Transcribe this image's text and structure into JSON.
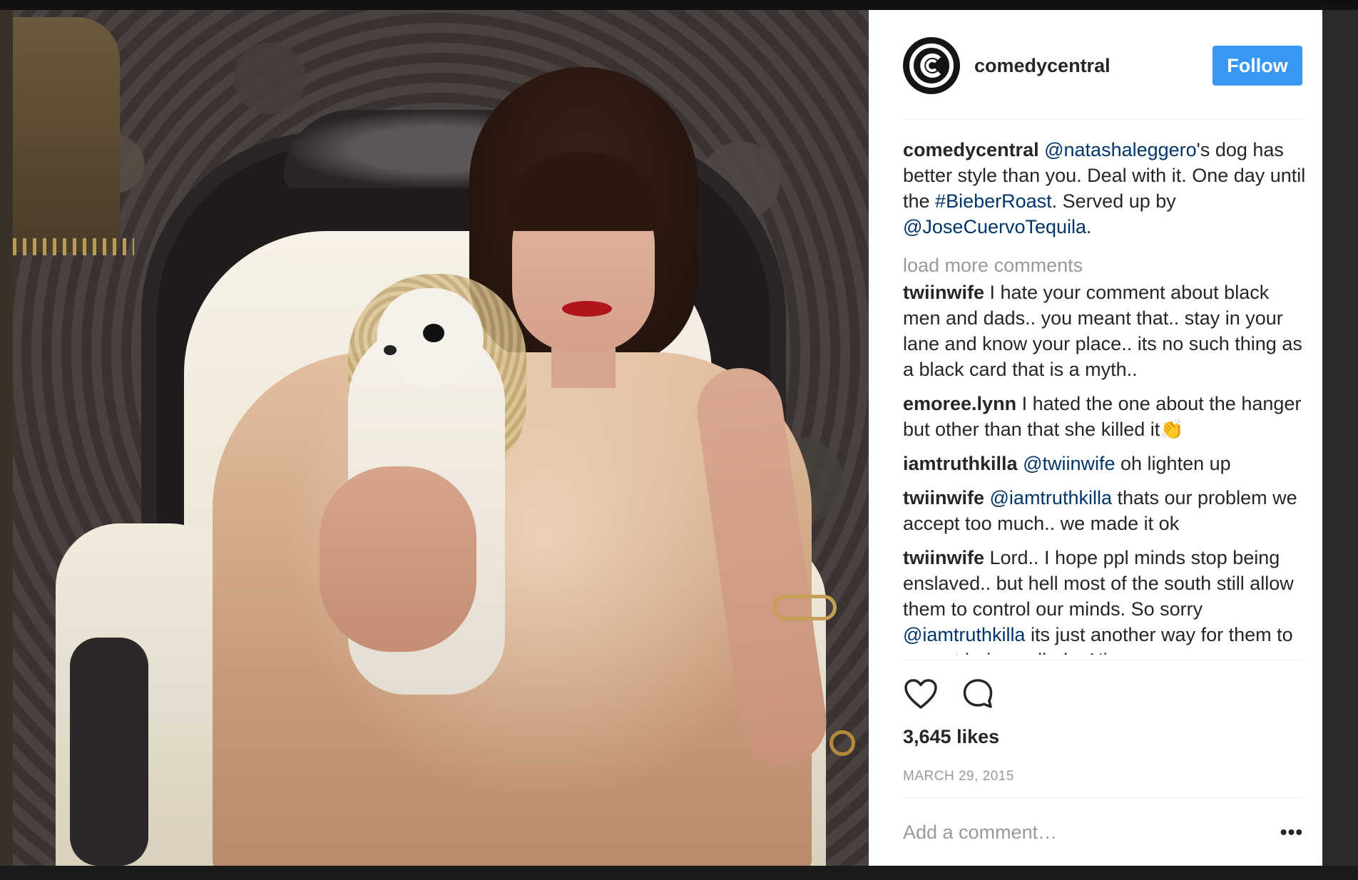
{
  "post": {
    "username": "comedycentral",
    "follow_label": "Follow"
  },
  "caption": {
    "author": "comedycentral",
    "mention_1": "@natashaleggero",
    "text_1": "'s dog has better style than you. Deal with it. One day until the ",
    "hashtag": "#BieberRoast",
    "text_2": ". Served up by ",
    "mention_2": "@JoseCuervoTequila",
    "text_3": "."
  },
  "load_more_label": "load more comments",
  "comments": [
    {
      "author": "twiinwife",
      "text": " I hate your comment about black men and dads.. you meant that.. stay in your lane and know your place.. its no such thing as a black card that is a myth.."
    },
    {
      "author": "emoree.lynn",
      "text": " I hated the one about the hanger but other than that she killed it👏"
    },
    {
      "author": "iamtruthkilla",
      "mention": "@twiinwife",
      "text": " oh lighten up"
    },
    {
      "author": "twiinwife",
      "mention": "@iamtruthkilla",
      "text": " thats our problem we accept too much.. we made it ok"
    },
    {
      "author": "twiinwife",
      "text_before": " Lord.. I hope ppl minds stop being enslaved.. but hell most of the south still allow them to control our minds. So sorry ",
      "mention": "@iamtruthkilla",
      "text": " its just another way for them to accept being called a Nigger"
    }
  ],
  "likes": "3,645 likes",
  "date": "MARCH 29, 2015",
  "add_comment_placeholder": "Add a comment…",
  "more_options_label": "•••",
  "icons": {
    "avatar": "comedy-central-logo-icon",
    "like": "heart-icon",
    "comment": "comment-bubble-icon",
    "more": "more-options-icon"
  },
  "colors": {
    "follow_button": "#3897f0",
    "mention": "#003569",
    "muted": "#999999",
    "text": "#262626"
  }
}
